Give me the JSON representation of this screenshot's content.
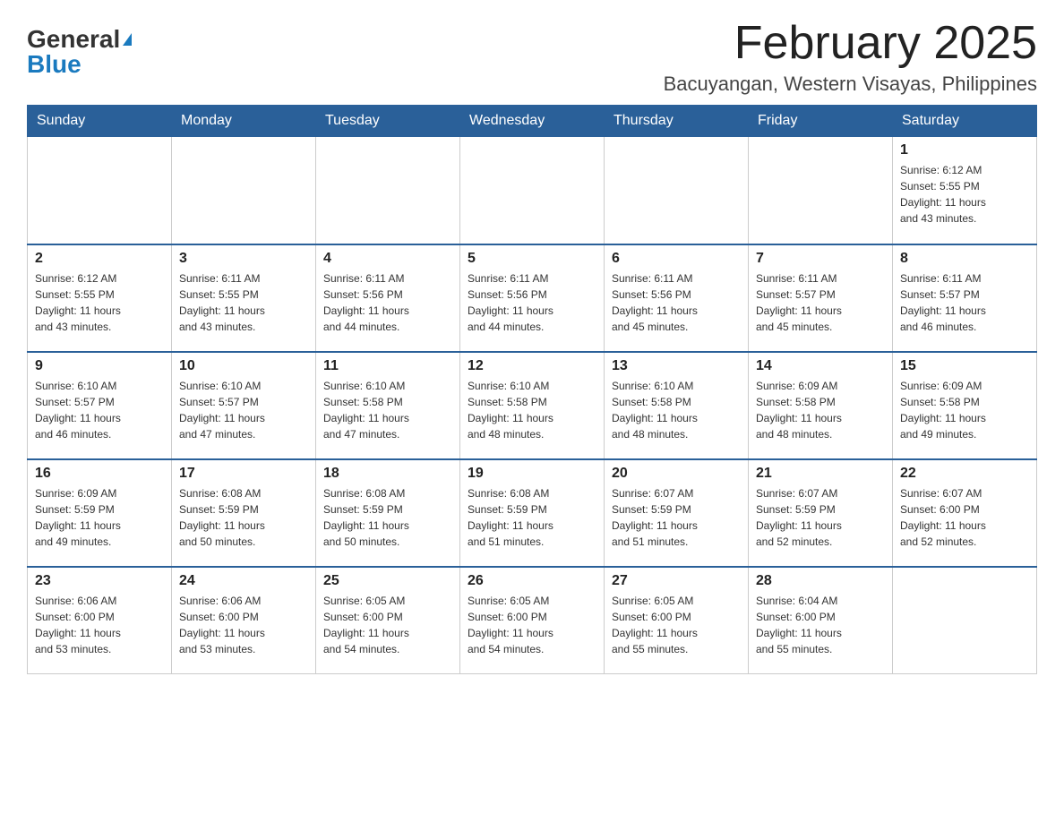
{
  "header": {
    "logo_general": "General",
    "logo_blue": "Blue",
    "month_title": "February 2025",
    "location": "Bacuyangan, Western Visayas, Philippines"
  },
  "days_of_week": [
    "Sunday",
    "Monday",
    "Tuesday",
    "Wednesday",
    "Thursday",
    "Friday",
    "Saturday"
  ],
  "weeks": [
    [
      {
        "day": "",
        "info": ""
      },
      {
        "day": "",
        "info": ""
      },
      {
        "day": "",
        "info": ""
      },
      {
        "day": "",
        "info": ""
      },
      {
        "day": "",
        "info": ""
      },
      {
        "day": "",
        "info": ""
      },
      {
        "day": "1",
        "info": "Sunrise: 6:12 AM\nSunset: 5:55 PM\nDaylight: 11 hours\nand 43 minutes."
      }
    ],
    [
      {
        "day": "2",
        "info": "Sunrise: 6:12 AM\nSunset: 5:55 PM\nDaylight: 11 hours\nand 43 minutes."
      },
      {
        "day": "3",
        "info": "Sunrise: 6:11 AM\nSunset: 5:55 PM\nDaylight: 11 hours\nand 43 minutes."
      },
      {
        "day": "4",
        "info": "Sunrise: 6:11 AM\nSunset: 5:56 PM\nDaylight: 11 hours\nand 44 minutes."
      },
      {
        "day": "5",
        "info": "Sunrise: 6:11 AM\nSunset: 5:56 PM\nDaylight: 11 hours\nand 44 minutes."
      },
      {
        "day": "6",
        "info": "Sunrise: 6:11 AM\nSunset: 5:56 PM\nDaylight: 11 hours\nand 45 minutes."
      },
      {
        "day": "7",
        "info": "Sunrise: 6:11 AM\nSunset: 5:57 PM\nDaylight: 11 hours\nand 45 minutes."
      },
      {
        "day": "8",
        "info": "Sunrise: 6:11 AM\nSunset: 5:57 PM\nDaylight: 11 hours\nand 46 minutes."
      }
    ],
    [
      {
        "day": "9",
        "info": "Sunrise: 6:10 AM\nSunset: 5:57 PM\nDaylight: 11 hours\nand 46 minutes."
      },
      {
        "day": "10",
        "info": "Sunrise: 6:10 AM\nSunset: 5:57 PM\nDaylight: 11 hours\nand 47 minutes."
      },
      {
        "day": "11",
        "info": "Sunrise: 6:10 AM\nSunset: 5:58 PM\nDaylight: 11 hours\nand 47 minutes."
      },
      {
        "day": "12",
        "info": "Sunrise: 6:10 AM\nSunset: 5:58 PM\nDaylight: 11 hours\nand 48 minutes."
      },
      {
        "day": "13",
        "info": "Sunrise: 6:10 AM\nSunset: 5:58 PM\nDaylight: 11 hours\nand 48 minutes."
      },
      {
        "day": "14",
        "info": "Sunrise: 6:09 AM\nSunset: 5:58 PM\nDaylight: 11 hours\nand 48 minutes."
      },
      {
        "day": "15",
        "info": "Sunrise: 6:09 AM\nSunset: 5:58 PM\nDaylight: 11 hours\nand 49 minutes."
      }
    ],
    [
      {
        "day": "16",
        "info": "Sunrise: 6:09 AM\nSunset: 5:59 PM\nDaylight: 11 hours\nand 49 minutes."
      },
      {
        "day": "17",
        "info": "Sunrise: 6:08 AM\nSunset: 5:59 PM\nDaylight: 11 hours\nand 50 minutes."
      },
      {
        "day": "18",
        "info": "Sunrise: 6:08 AM\nSunset: 5:59 PM\nDaylight: 11 hours\nand 50 minutes."
      },
      {
        "day": "19",
        "info": "Sunrise: 6:08 AM\nSunset: 5:59 PM\nDaylight: 11 hours\nand 51 minutes."
      },
      {
        "day": "20",
        "info": "Sunrise: 6:07 AM\nSunset: 5:59 PM\nDaylight: 11 hours\nand 51 minutes."
      },
      {
        "day": "21",
        "info": "Sunrise: 6:07 AM\nSunset: 5:59 PM\nDaylight: 11 hours\nand 52 minutes."
      },
      {
        "day": "22",
        "info": "Sunrise: 6:07 AM\nSunset: 6:00 PM\nDaylight: 11 hours\nand 52 minutes."
      }
    ],
    [
      {
        "day": "23",
        "info": "Sunrise: 6:06 AM\nSunset: 6:00 PM\nDaylight: 11 hours\nand 53 minutes."
      },
      {
        "day": "24",
        "info": "Sunrise: 6:06 AM\nSunset: 6:00 PM\nDaylight: 11 hours\nand 53 minutes."
      },
      {
        "day": "25",
        "info": "Sunrise: 6:05 AM\nSunset: 6:00 PM\nDaylight: 11 hours\nand 54 minutes."
      },
      {
        "day": "26",
        "info": "Sunrise: 6:05 AM\nSunset: 6:00 PM\nDaylight: 11 hours\nand 54 minutes."
      },
      {
        "day": "27",
        "info": "Sunrise: 6:05 AM\nSunset: 6:00 PM\nDaylight: 11 hours\nand 55 minutes."
      },
      {
        "day": "28",
        "info": "Sunrise: 6:04 AM\nSunset: 6:00 PM\nDaylight: 11 hours\nand 55 minutes."
      },
      {
        "day": "",
        "info": ""
      }
    ]
  ]
}
